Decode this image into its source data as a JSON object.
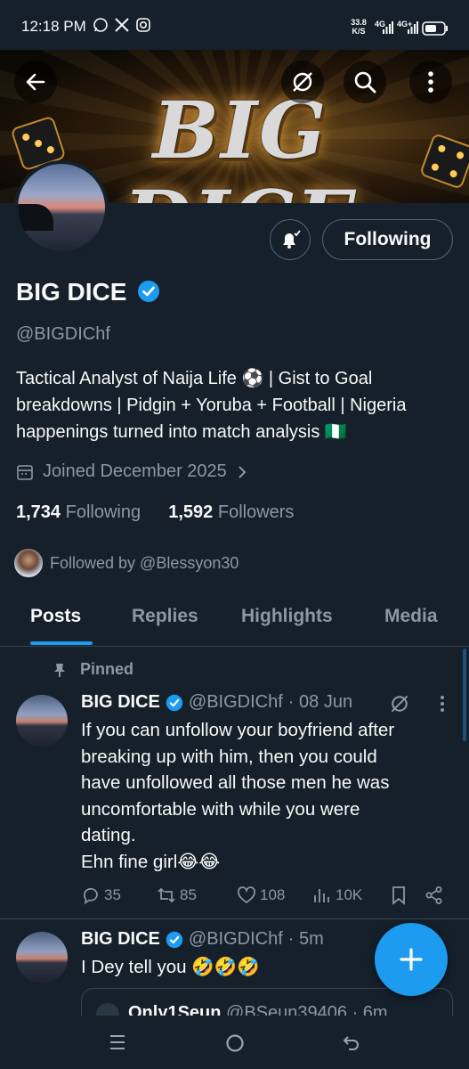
{
  "status_bar": {
    "time": "12:18 PM",
    "speed_value": "33.8",
    "speed_unit": "K/S",
    "net1": "4G",
    "net2": "4G+",
    "apps": [
      "whatsapp-icon",
      "x-icon",
      "instagram-icon"
    ]
  },
  "banner": {
    "title": "BIG DICE"
  },
  "profile": {
    "name": "BIG DICE",
    "handle": "@BIGDIChf",
    "bio": "Tactical Analyst of Naija Life ⚽ | Gist to Goal breakdowns | Pidgin + Yoruba + Football | Nigeria happenings turned into match analysis 🇳🇬",
    "joined": "Joined December 2025",
    "following_count": "1,734",
    "following_label": "Following",
    "followers_count": "1,592",
    "followers_label": "Followers",
    "followed_by": "Followed by @Blessyon30",
    "follow_button": "Following"
  },
  "tabs": [
    "Posts",
    "Replies",
    "Highlights",
    "Media"
  ],
  "tweets": [
    {
      "pinned_label": "Pinned",
      "name": "BIG DICE",
      "handle": "@BIGDIChf",
      "time": "· 08 Jun",
      "text_lines": [
        "If you can unfollow your boyfriend after",
        "breaking up with him, then you could",
        "have unfollowed all those men he was",
        "uncomfortable with while you were",
        "dating.",
        "Ehn fine girl😂😂"
      ],
      "replies": "35",
      "reposts": "85",
      "likes": "108",
      "views": "10K"
    },
    {
      "name": "BIG DICE",
      "handle": "@BIGDIChf",
      "time": "· 5m",
      "text": "I Dey tell you 🤣🤣🤣",
      "quote_name": "Only1Seun",
      "quote_handle": "@BSeun39406 · 6m"
    }
  ],
  "colors": {
    "accent": "#1d9bf0",
    "background": "#15202b",
    "muted": "#8b98a5",
    "border": "#38444d"
  }
}
